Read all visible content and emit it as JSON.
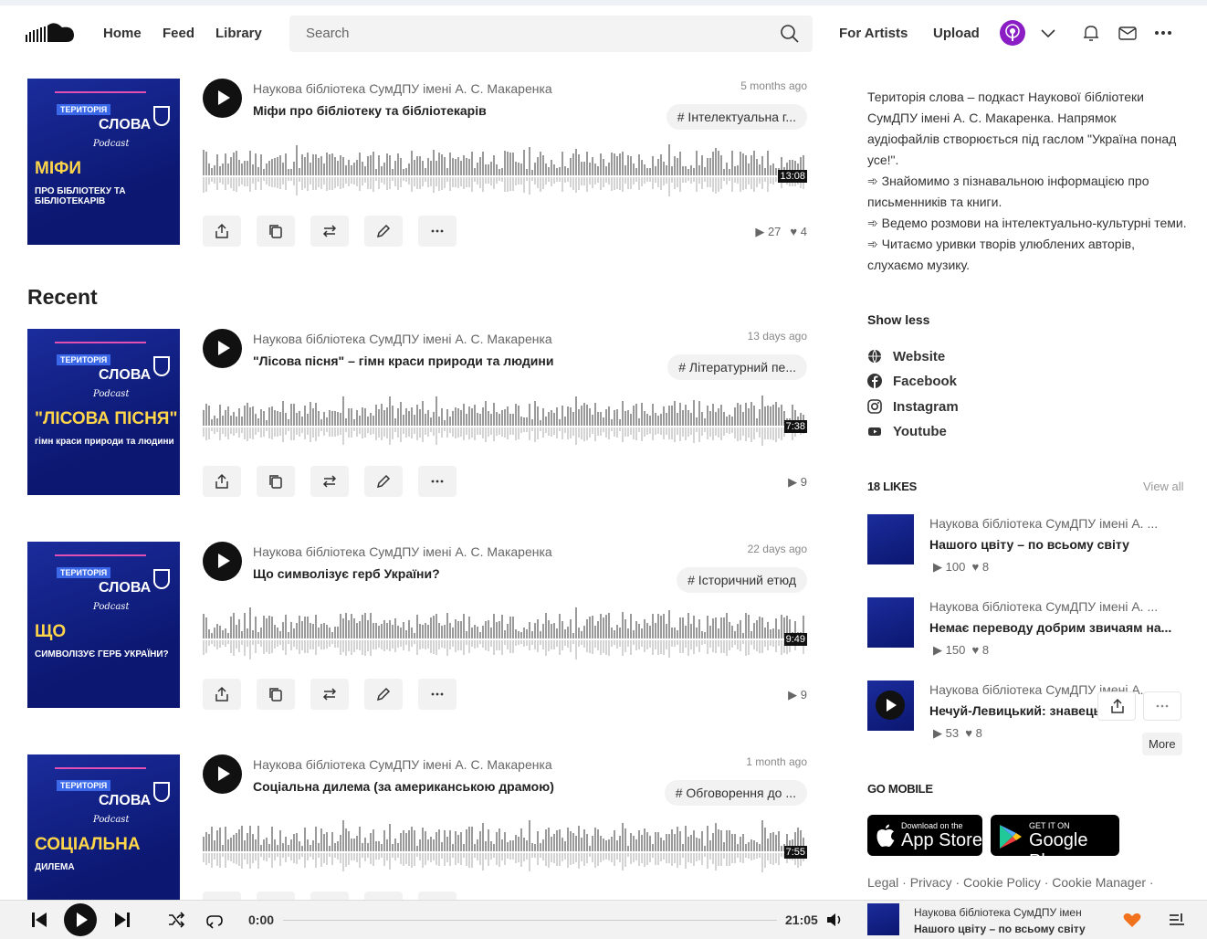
{
  "header": {
    "nav": [
      "Home",
      "Feed",
      "Library"
    ],
    "search_placeholder": "Search",
    "for_artists": "For Artists",
    "upload": "Upload"
  },
  "feed": {
    "recent_heading": "Recent",
    "tracks": [
      {
        "artist": "Наукова бібліотека СумДПУ імені А. С. Макаренка",
        "title": "Міфи про бібліотеку та бібліотекарів",
        "time": "5 months ago",
        "genre": "# Інтелектуальна г...",
        "duration": "13:08",
        "plays": "27",
        "likes": "4",
        "art": {
          "top": "ТЕРИТОРІЯ",
          "name": "СЛОВА",
          "podcast": "Podcast",
          "big": "МІФИ",
          "small": "ПРО БІБЛІОТЕКУ ТА БІБЛІОТЕКАРІВ"
        }
      },
      {
        "artist": "Наукова бібліотека СумДПУ імені А. С. Макаренка",
        "title": "\"Лісова пісня\" – гімн краси природи та людини",
        "time": "13 days ago",
        "genre": "# Літературний пе...",
        "duration": "7:38",
        "plays": "9",
        "likes": "",
        "art": {
          "top": "ТЕРИТОРІЯ",
          "name": "СЛОВА",
          "podcast": "Podcast",
          "big": "\"ЛІСОВА ПІСНЯ\"",
          "small": "гімн краси природи та людини"
        }
      },
      {
        "artist": "Наукова бібліотека СумДПУ імені А. С. Макаренка",
        "title": "Що символізує герб України?",
        "time": "22 days ago",
        "genre": "# Історичний етюд",
        "duration": "9:49",
        "plays": "9",
        "likes": "",
        "art": {
          "top": "ТЕРИТОРІЯ",
          "name": "СЛОВА",
          "podcast": "Podcast",
          "big": "ЩО",
          "small": "СИМВОЛІЗУЄ ГЕРБ УКРАЇНИ?"
        }
      },
      {
        "artist": "Наукова бібліотека СумДПУ імені А. С. Макаренка",
        "title": "Соціальна дилема (за американською драмою)",
        "time": "1 month ago",
        "genre": "# Обговорення до ...",
        "duration": "7:55",
        "plays": "",
        "likes": "",
        "art": {
          "top": "ТЕРИТОРІЯ",
          "name": "СЛОВА",
          "podcast": "Podcast",
          "big": "СОЦІАЛЬНА",
          "small": "ДИЛЕМА"
        }
      }
    ]
  },
  "sidebar": {
    "description": [
      "Територія слова – подкаст Наукової бібліотеки СумДПУ імені А. С. Макаренка. Напрямок аудіофайлів створюється під гаслом \"Україна понад усе!\".",
      "➾ Знайомимо з пізнавальною інформацією про письменників та книги.",
      "➾ Ведемо розмови на інтелектуально-культурні теми.",
      "➾ Читаємо уривки творів улюблених авторів, слухаємо музику."
    ],
    "show_less": "Show less",
    "links": [
      "Website",
      "Facebook",
      "Instagram",
      "Youtube"
    ],
    "likes_heading": "18 LIKES",
    "view_all": "View all",
    "likes": [
      {
        "artist": "Наукова бібліотека СумДПУ імені А. ...",
        "title": "Нашого цвіту – по всьому світу",
        "plays": "100",
        "likes": "8"
      },
      {
        "artist": "Наукова бібліотека СумДПУ імені А. ...",
        "title": "Немає переводу добрим звичаям на...",
        "plays": "150",
        "likes": "8"
      },
      {
        "artist": "Наукова бібліотека СумДПУ імені А. ...",
        "title": "Нечуй-Левицький: знавець",
        "plays": "53",
        "likes": "8"
      }
    ],
    "more_tooltip": "More",
    "go_mobile": "GO MOBILE",
    "app_store": {
      "line1": "Download on the",
      "line2": "App Store"
    },
    "google_play": {
      "line1": "GET IT ON",
      "line2": "Google Play"
    },
    "legal": "Legal · Privacy · Cookie Policy · Cookie Manager ·"
  },
  "player": {
    "current": "0:00",
    "total": "21:05",
    "artist": "Наукова бібліотека СумДПУ імен",
    "title": "Нашого цвіту – по всьому світу"
  }
}
